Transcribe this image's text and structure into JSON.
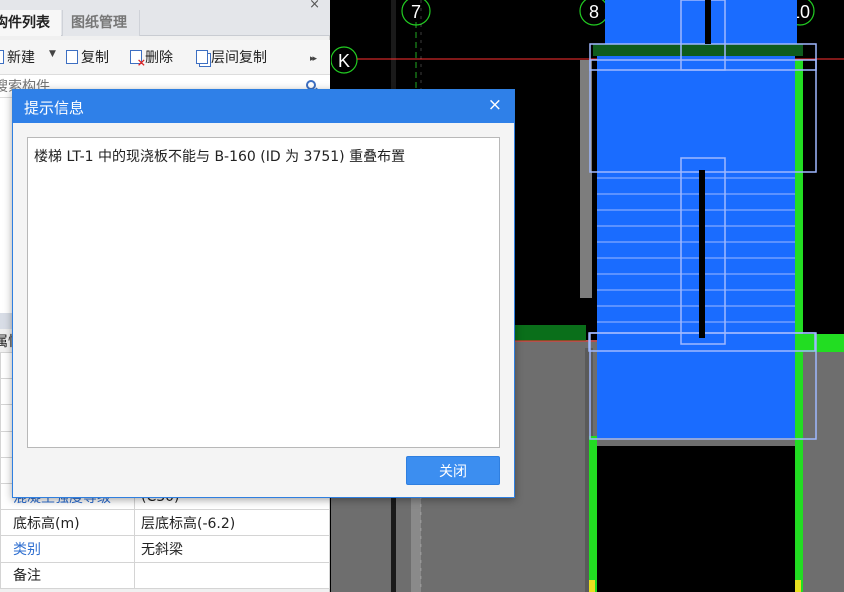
{
  "panel": {
    "tabs": [
      {
        "label": "构件列表"
      },
      {
        "label": "图纸管理"
      }
    ],
    "close_glyph": "×"
  },
  "toolbar": {
    "new_label": "新建",
    "copy_label": "复制",
    "delete_label": "删除",
    "floor_copy_label": "层间复制",
    "more_glyph": "▸▸"
  },
  "search": {
    "placeholder": "搜索构件..."
  },
  "properties": {
    "title": "属性",
    "rows": [
      {
        "name": "",
        "value": ""
      },
      {
        "name": "",
        "value": ""
      },
      {
        "name": "",
        "value": ""
      },
      {
        "name": "",
        "value": ""
      },
      {
        "name": "",
        "value": ""
      },
      {
        "name": "混凝土强度等级",
        "value": "(C30)"
      },
      {
        "name": "底标高(m)",
        "value": "层底标高(-6.2)"
      },
      {
        "name": "类别",
        "value": "无斜梁"
      },
      {
        "name": "备注",
        "value": ""
      }
    ]
  },
  "cad": {
    "axis_labels": [
      "7",
      "8",
      "9",
      "10",
      "K"
    ],
    "colors": {
      "stair_fill": "#1a6cff",
      "wireframe": "#9fb8ff",
      "beam_green": "#22dd22",
      "dark_green": "#0a6f1a",
      "slab_gray": "#6e6e6e",
      "axis_red": "#ff3030"
    }
  },
  "dialog": {
    "title": "提示信息",
    "close_glyph": "×",
    "message": "楼梯 LT-1 中的现浇板不能与 B-160 (ID 为 3751) 重叠布置",
    "close_button": "关闭"
  }
}
